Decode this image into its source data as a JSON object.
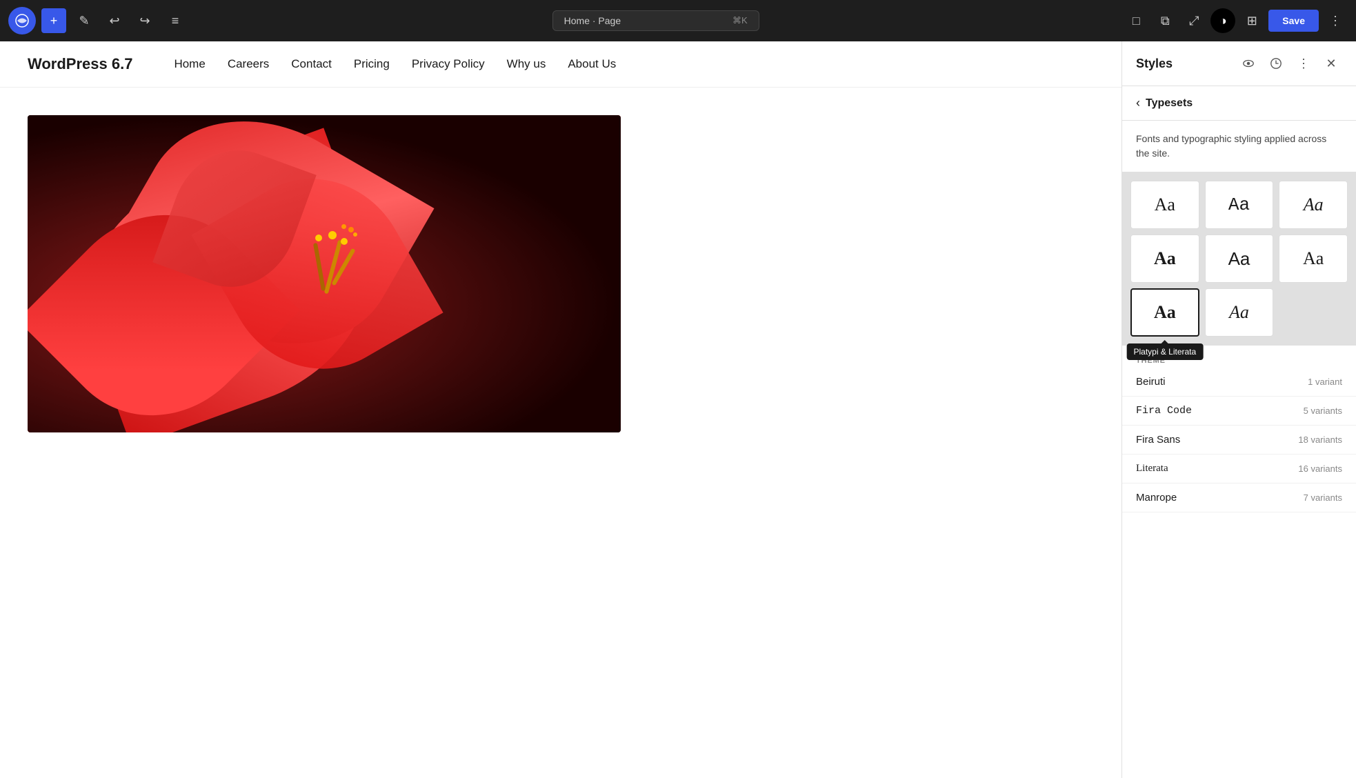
{
  "toolbar": {
    "wp_logo": "W",
    "add_label": "+",
    "edit_label": "✎",
    "undo_label": "↩",
    "redo_label": "↪",
    "list_view_label": "≡",
    "page_title": "Home · Page",
    "shortcut": "⌘K",
    "view_label": "□",
    "external_label": "⧉",
    "resize_label": "⤢",
    "contrast_label": "◑",
    "layout_label": "⊞",
    "save_label": "Save",
    "more_label": "⋮"
  },
  "site": {
    "logo": "WordPress 6.7",
    "nav": [
      {
        "label": "Home"
      },
      {
        "label": "Careers"
      },
      {
        "label": "Contact"
      },
      {
        "label": "Pricing"
      },
      {
        "label": "Privacy Policy"
      },
      {
        "label": "Why us"
      },
      {
        "label": "About Us"
      }
    ]
  },
  "panel": {
    "styles_title": "Styles",
    "back_label": "‹",
    "typesets_title": "Typesets",
    "description": "Fonts and typographic styling applied across the site.",
    "typesets": [
      {
        "label": "Aa",
        "style": "serif"
      },
      {
        "label": "Aa",
        "style": "mono"
      },
      {
        "label": "Aa",
        "style": "serif-italic"
      },
      {
        "label": "Aa",
        "style": "serif-bold"
      },
      {
        "label": "Aa",
        "style": "sans"
      },
      {
        "label": "Aa",
        "style": "palatino"
      },
      {
        "label": "Aa",
        "style": "serif-black"
      },
      {
        "label": "Aa",
        "style": "times-italic"
      }
    ],
    "selected_typeset_index": 6,
    "tooltip_text": "Platypi & Literata",
    "theme_label": "THEME",
    "fonts": [
      {
        "name": "Beiruti",
        "name_style": "normal",
        "variants": "1 variant"
      },
      {
        "name": "Fira Code",
        "name_style": "mono",
        "variants": "5 variants"
      },
      {
        "name": "Fira Sans",
        "name_style": "normal",
        "variants": "18 variants"
      },
      {
        "name": "Literata",
        "name_style": "normal",
        "variants": "16 variants"
      },
      {
        "name": "Manrope",
        "name_style": "normal",
        "variants": "7 variants"
      }
    ]
  }
}
